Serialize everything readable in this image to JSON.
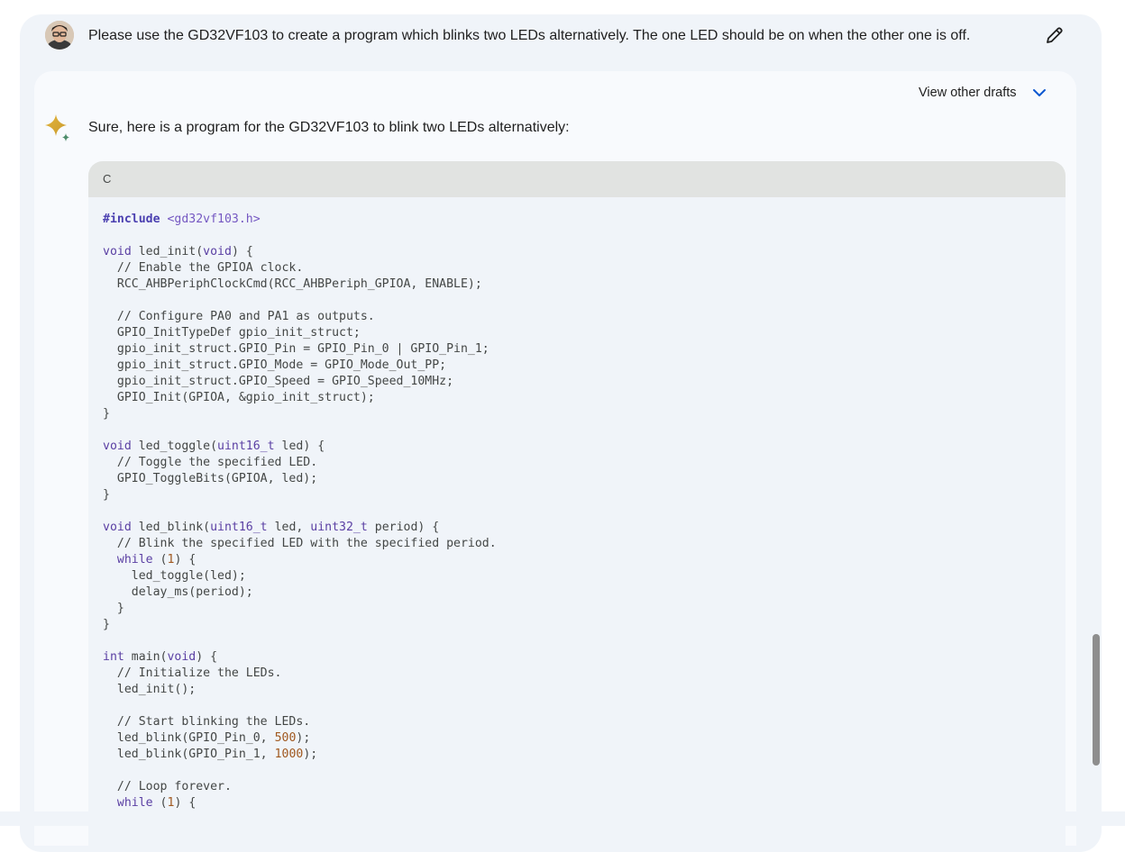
{
  "conversation": {
    "user_prompt": "Please use the GD32VF103 to create a program which blinks two LEDs alternatively. The one LED should be on when the other one is off.",
    "edit_icon": "pencil-icon",
    "avatar_icon": "user-avatar"
  },
  "response": {
    "drafts_label": "View other drafts",
    "drafts_icon": "chevron-down-icon",
    "assistant_icon": "sparkle-icon",
    "intro": "Sure, here is a program for the GD32VF103 to blink two LEDs alternatively:",
    "code": {
      "language": "C",
      "lines": [
        "#include <gd32vf103.h>",
        "",
        "void led_init(void) {",
        "  // Enable the GPIOA clock.",
        "  RCC_AHBPeriphClockCmd(RCC_AHBPeriph_GPIOA, ENABLE);",
        "",
        "  // Configure PA0 and PA1 as outputs.",
        "  GPIO_InitTypeDef gpio_init_struct;",
        "  gpio_init_struct.GPIO_Pin = GPIO_Pin_0 | GPIO_Pin_1;",
        "  gpio_init_struct.GPIO_Mode = GPIO_Mode_Out_PP;",
        "  gpio_init_struct.GPIO_Speed = GPIO_Speed_10MHz;",
        "  GPIO_Init(GPIOA, &gpio_init_struct);",
        "}",
        "",
        "void led_toggle(uint16_t led) {",
        "  // Toggle the specified LED.",
        "  GPIO_ToggleBits(GPIOA, led);",
        "}",
        "",
        "void led_blink(uint16_t led, uint32_t period) {",
        "  // Blink the specified LED with the specified period.",
        "  while (1) {",
        "    led_toggle(led);",
        "    delay_ms(period);",
        "  }",
        "}",
        "",
        "int main(void) {",
        "  // Initialize the LEDs.",
        "  led_init();",
        "",
        "  // Start blinking the LEDs.",
        "  led_blink(GPIO_Pin_0, 500);",
        "  led_blink(GPIO_Pin_1, 1000);",
        "",
        "  // Loop forever.",
        "  while (1) {"
      ]
    }
  },
  "colors": {
    "page_bg": "#f0f4f9",
    "card_bg": "#f8fafd",
    "code_header_bg": "#e1e3e1",
    "keyword": "#5a3fa3",
    "number": "#a0581f",
    "accent": "#0b57d0"
  }
}
